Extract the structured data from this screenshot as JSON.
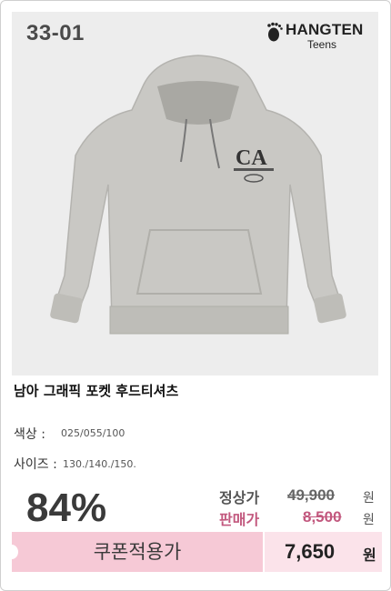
{
  "product": {
    "code": "33-01",
    "brand_name": "HANGTEN",
    "brand_sub": "Teens",
    "title": "남아 그래픽 포켓 후드티셔츠",
    "graphic_text": "CA",
    "color_label": "색상 :",
    "color_value": "025/055/100",
    "size_label": "사이즈 :",
    "size_value": "130./140./150."
  },
  "pricing": {
    "discount": "84%",
    "regular_label": "정상가",
    "regular_price": "49,900",
    "sale_label": "판매가",
    "sale_price": "8,500",
    "currency": "원"
  },
  "coupon": {
    "label": "쿠폰적용가",
    "price": "7,650",
    "currency": "원"
  },
  "colors": {
    "accent_pink": "#f6c9d6",
    "sale_text": "#c2587e",
    "photo_bg": "#ededed"
  }
}
